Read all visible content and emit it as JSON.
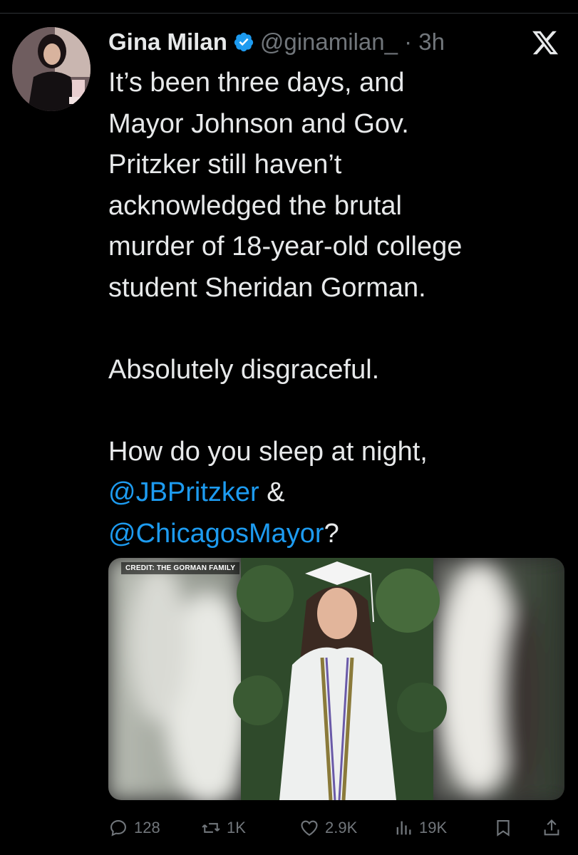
{
  "tweet": {
    "author_name": "Gina Milan",
    "handle_time": "@ginamilan_ · 3h",
    "text_lines": [
      "It’s been three days, and",
      "Mayor Johnson and Gov.",
      "Pritzker still haven’t",
      "acknowledged the brutal",
      "murder of 18-year-old college",
      "student Sheridan Gorman.",
      "",
      "Absolutely disgraceful.",
      "",
      "How do you sleep at night,"
    ],
    "mention1": "@JBPritzker",
    "amp": " &",
    "mention2": "@ChicagosMayor",
    "question": "?",
    "media_credit": "CREDIT: THE GORMAN FAMILY"
  },
  "actions": {
    "replies": "128",
    "reposts": "1K",
    "likes": "2.9K",
    "views": "19K"
  },
  "icons": [
    "verified-badge-icon",
    "x-logo-icon",
    "reply-icon",
    "repost-icon",
    "like-icon",
    "views-icon",
    "bookmark-icon",
    "share-icon"
  ],
  "colors": {
    "background": "#000000",
    "text": "#e7e9ea",
    "muted": "#71767b",
    "link": "#1d9bf0"
  }
}
